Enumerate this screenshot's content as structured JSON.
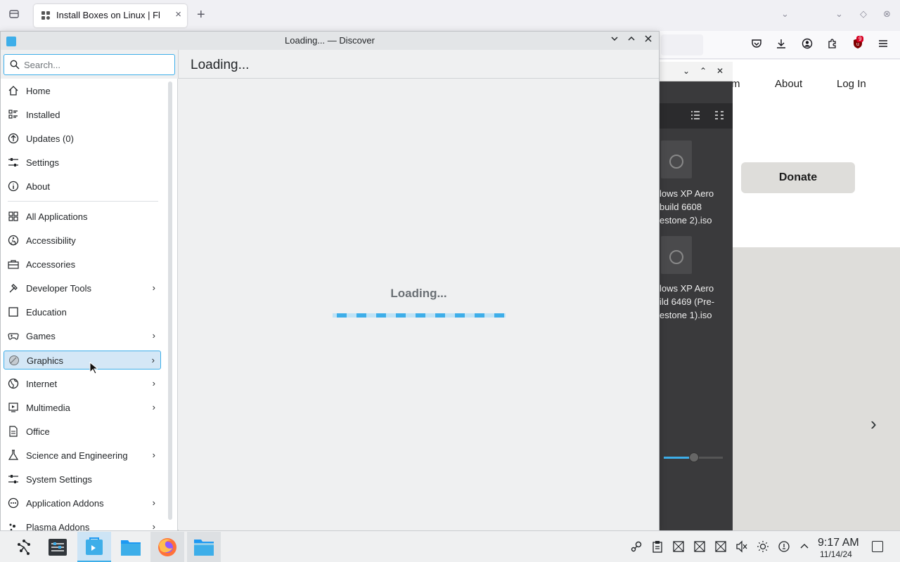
{
  "firefox": {
    "tab_title": "Install Boxes on Linux | Fl",
    "tab_close": "×",
    "new_tab": "+",
    "toolbar_icons": [
      "pocket-icon",
      "download-icon",
      "account-icon",
      "extensions-icon",
      "ublock-icon",
      "menu-icon"
    ],
    "ublock_badge": "9"
  },
  "website": {
    "nav_partial": "m",
    "nav_about": "About",
    "nav_login": "Log In",
    "donate": "Donate",
    "next_arrow": "›"
  },
  "file_manager": {
    "files": [
      {
        "lines": [
          "lows XP Aero",
          "build 6608",
          "estone 2).iso"
        ]
      },
      {
        "lines": [
          "lows XP Aero",
          "ild 6469 (Pre-",
          "estone 1).iso"
        ]
      }
    ]
  },
  "discover": {
    "window_title": "Loading... — Discover",
    "search_placeholder": "Search...",
    "header_title": "Loading...",
    "loading_text": "Loading...",
    "nav": [
      {
        "label": "Home",
        "icon": "home-icon"
      },
      {
        "label": "Installed",
        "icon": "installed-icon"
      },
      {
        "label": "Updates (0)",
        "icon": "updates-icon"
      },
      {
        "label": "Settings",
        "icon": "settings-icon"
      },
      {
        "label": "About",
        "icon": "info-icon"
      }
    ],
    "categories": [
      {
        "label": "All Applications",
        "icon": "grid-icon",
        "submenu": false
      },
      {
        "label": "Accessibility",
        "icon": "accessibility-icon",
        "submenu": false
      },
      {
        "label": "Accessories",
        "icon": "toolbox-icon",
        "submenu": false
      },
      {
        "label": "Developer Tools",
        "icon": "hammer-icon",
        "submenu": true
      },
      {
        "label": "Education",
        "icon": "education-icon",
        "submenu": false
      },
      {
        "label": "Games",
        "icon": "gamepad-icon",
        "submenu": true
      },
      {
        "label": "Graphics",
        "icon": "graphics-icon",
        "submenu": true,
        "active": true
      },
      {
        "label": "Internet",
        "icon": "globe-icon",
        "submenu": true
      },
      {
        "label": "Multimedia",
        "icon": "multimedia-icon",
        "submenu": true
      },
      {
        "label": "Office",
        "icon": "document-icon",
        "submenu": false
      },
      {
        "label": "Science and Engineering",
        "icon": "flask-icon",
        "submenu": true
      },
      {
        "label": "System Settings",
        "icon": "sliders-icon",
        "submenu": false
      },
      {
        "label": "Application Addons",
        "icon": "addons-icon",
        "submenu": true
      },
      {
        "label": "Plasma Addons",
        "icon": "plasma-icon",
        "submenu": true
      }
    ]
  },
  "taskbar": {
    "apps": [
      "application-launcher-icon",
      "system-monitor-icon",
      "discover-icon",
      "dolphin-icon",
      "firefox-icon",
      "file-manager-icon"
    ],
    "time": "9:17 AM",
    "date": "11/14/24"
  },
  "colors": {
    "accent": "#3daee9",
    "selection": "#d4e7f6",
    "window_bg": "#eff0f1",
    "dark_panel": "#3a3a3c"
  }
}
